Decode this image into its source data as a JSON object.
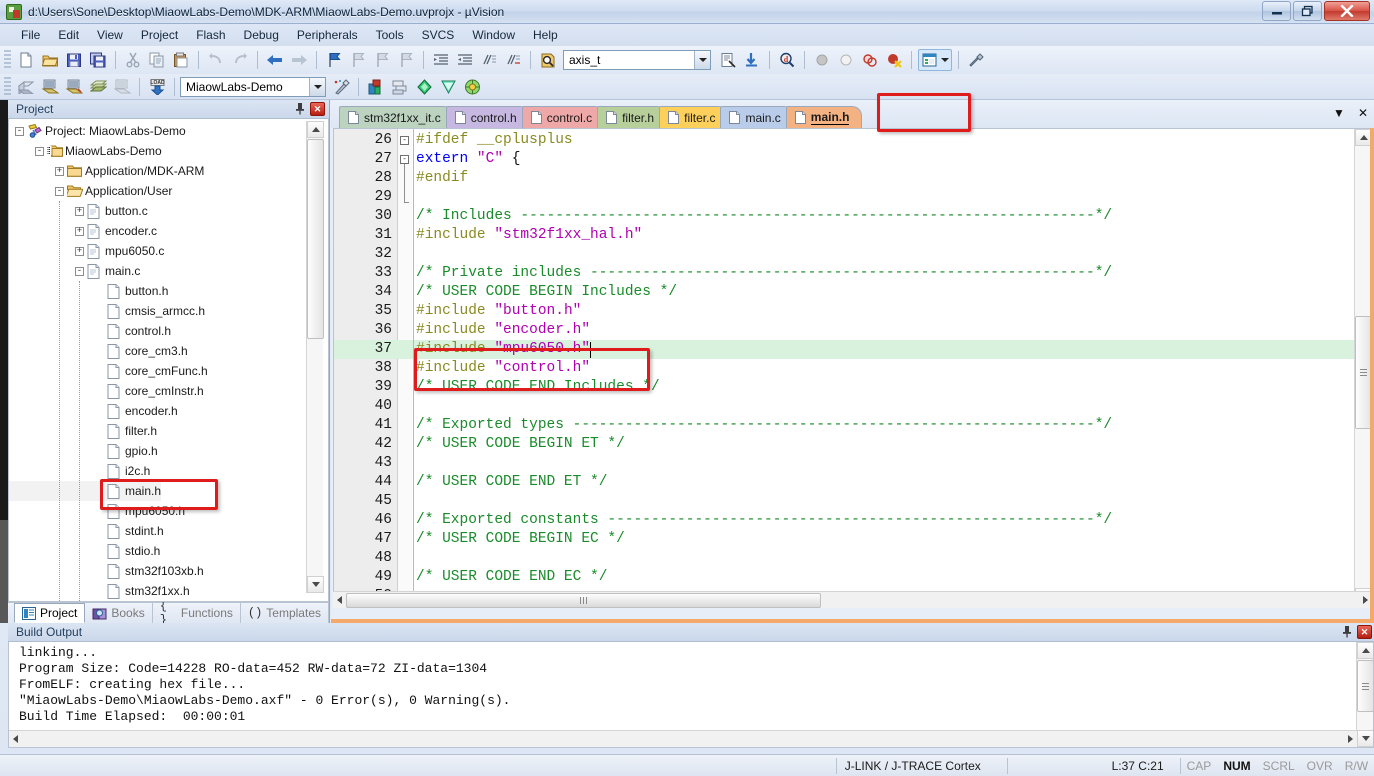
{
  "window": {
    "title": "d:\\Users\\Sone\\Desktop\\MiaowLabs-Demo\\MDK-ARM\\MiaowLabs-Demo.uvprojx - µVision",
    "app_icon": "uvision-icon",
    "minimize_label": "–",
    "maximize_label": "❐",
    "close_label": "✕"
  },
  "menubar": {
    "items": [
      {
        "label": "File"
      },
      {
        "label": "Edit"
      },
      {
        "label": "View"
      },
      {
        "label": "Project"
      },
      {
        "label": "Flash"
      },
      {
        "label": "Debug"
      },
      {
        "label": "Peripherals"
      },
      {
        "label": "Tools"
      },
      {
        "label": "SVCS"
      },
      {
        "label": "Window"
      },
      {
        "label": "Help"
      }
    ]
  },
  "toolbar_main": {
    "buttons": [
      {
        "name": "new-file-icon"
      },
      {
        "name": "open-file-icon"
      },
      {
        "name": "save-icon"
      },
      {
        "name": "save-all-icon"
      },
      {
        "name": "cut-icon"
      },
      {
        "name": "copy-icon"
      },
      {
        "name": "paste-icon"
      },
      {
        "name": "undo-icon"
      },
      {
        "name": "redo-icon"
      },
      {
        "name": "navigate-back-icon"
      },
      {
        "name": "navigate-forward-icon"
      },
      {
        "name": "bookmark-toggle-icon"
      },
      {
        "name": "bookmark-prev-icon"
      },
      {
        "name": "bookmark-next-icon"
      },
      {
        "name": "bookmark-clear-icon"
      },
      {
        "name": "indent-icon"
      },
      {
        "name": "outdent-icon"
      },
      {
        "name": "comment-icon"
      },
      {
        "name": "uncomment-icon"
      },
      {
        "name": "find-in-files-icon"
      }
    ],
    "search_value": "axis_t",
    "search_placeholder": "",
    "right_buttons": [
      {
        "name": "browse-info-icon"
      },
      {
        "name": "goto-definition-icon"
      },
      {
        "name": "find-icon"
      },
      {
        "name": "start-debug-grey-icon"
      },
      {
        "name": "stop-debug-grey-icon"
      },
      {
        "name": "insert-breakpoint-icon"
      },
      {
        "name": "kill-all-breakpoints-icon"
      },
      {
        "name": "manage-windows-icon"
      },
      {
        "name": "configure-icon"
      }
    ]
  },
  "toolbar_build": {
    "buttons": [
      {
        "name": "translate-file-icon"
      },
      {
        "name": "build-target-icon"
      },
      {
        "name": "rebuild-all-icon"
      },
      {
        "name": "batch-build-icon"
      },
      {
        "name": "stop-build-icon"
      },
      {
        "name": "download-to-flash-icon"
      }
    ],
    "target_value": "MiaowLabs-Demo",
    "right_buttons": [
      {
        "name": "target-options-wizard-icon"
      },
      {
        "name": "options-for-target-icon"
      },
      {
        "name": "manage-project-items-icon"
      },
      {
        "name": "pack-installer-icon"
      },
      {
        "name": "run-time-environment-icon"
      },
      {
        "name": "multi-project-icon"
      }
    ]
  },
  "project_panel": {
    "title": "Project",
    "pin_icon": "pin-icon",
    "close_icon": "close-icon",
    "tree": [
      {
        "label": "Project: MiaowLabs-Demo",
        "depth": 0,
        "expander": "-",
        "icon": "project-icon"
      },
      {
        "label": "MiaowLabs-Demo",
        "depth": 1,
        "expander": "-",
        "icon": "target-icon"
      },
      {
        "label": "Application/MDK-ARM",
        "depth": 2,
        "expander": "+",
        "icon": "folder-closed-icon"
      },
      {
        "label": "Application/User",
        "depth": 2,
        "expander": "-",
        "icon": "folder-open-icon"
      },
      {
        "label": "button.c",
        "depth": 3,
        "expander": "+",
        "icon": "c-file-icon"
      },
      {
        "label": "encoder.c",
        "depth": 3,
        "expander": "+",
        "icon": "c-file-icon"
      },
      {
        "label": "mpu6050.c",
        "depth": 3,
        "expander": "+",
        "icon": "c-file-icon"
      },
      {
        "label": "main.c",
        "depth": 3,
        "expander": "-",
        "icon": "c-file-icon"
      },
      {
        "label": "button.h",
        "depth": 4,
        "expander": "",
        "icon": "h-file-icon"
      },
      {
        "label": "cmsis_armcc.h",
        "depth": 4,
        "expander": "",
        "icon": "h-file-icon"
      },
      {
        "label": "control.h",
        "depth": 4,
        "expander": "",
        "icon": "h-file-icon"
      },
      {
        "label": "core_cm3.h",
        "depth": 4,
        "expander": "",
        "icon": "h-file-icon"
      },
      {
        "label": "core_cmFunc.h",
        "depth": 4,
        "expander": "",
        "icon": "h-file-icon"
      },
      {
        "label": "core_cmInstr.h",
        "depth": 4,
        "expander": "",
        "icon": "h-file-icon"
      },
      {
        "label": "encoder.h",
        "depth": 4,
        "expander": "",
        "icon": "h-file-icon"
      },
      {
        "label": "filter.h",
        "depth": 4,
        "expander": "",
        "icon": "h-file-icon"
      },
      {
        "label": "gpio.h",
        "depth": 4,
        "expander": "",
        "icon": "h-file-icon"
      },
      {
        "label": "i2c.h",
        "depth": 4,
        "expander": "",
        "icon": "h-file-icon"
      },
      {
        "label": "main.h",
        "depth": 4,
        "expander": "",
        "icon": "h-file-icon",
        "selected": true
      },
      {
        "label": "mpu6050.h",
        "depth": 4,
        "expander": "",
        "icon": "h-file-icon"
      },
      {
        "label": "stdint.h",
        "depth": 4,
        "expander": "",
        "icon": "h-file-icon"
      },
      {
        "label": "stdio.h",
        "depth": 4,
        "expander": "",
        "icon": "h-file-icon"
      },
      {
        "label": "stm32f103xb.h",
        "depth": 4,
        "expander": "",
        "icon": "h-file-icon"
      },
      {
        "label": "stm32f1xx.h",
        "depth": 4,
        "expander": "",
        "icon": "h-file-icon"
      }
    ],
    "tabs": [
      {
        "label": "Project",
        "icon": "project-tab-icon",
        "active": true
      },
      {
        "label": "Books",
        "icon": "books-tab-icon",
        "active": false
      },
      {
        "label": "Functions",
        "icon": "functions-tab-icon",
        "active": false
      },
      {
        "label": "Templates",
        "icon": "templates-tab-icon",
        "active": false
      }
    ]
  },
  "editor": {
    "tabs": [
      {
        "label": "stm32f1xx_it.c",
        "color": "#bcd3c0",
        "active": false
      },
      {
        "label": "control.h",
        "color": "#c6b8e0",
        "active": false
      },
      {
        "label": "control.c",
        "color": "#efa8a8",
        "active": false
      },
      {
        "label": "filter.h",
        "color": "#b7cf9a",
        "active": false
      },
      {
        "label": "filter.c",
        "color": "#fcd05a",
        "active": false
      },
      {
        "label": "main.c",
        "color": "#b9ccea",
        "active": false
      },
      {
        "label": "main.h",
        "color": "#f4b283",
        "active": true
      }
    ],
    "tab_controls": [
      {
        "name": "tab-list-dropdown-icon",
        "label": "▼"
      },
      {
        "name": "close-tab-icon",
        "label": "✕"
      }
    ],
    "first_line": 26,
    "current_line": 37,
    "lines": [
      {
        "n": 26,
        "fold": "-",
        "tokens": [
          {
            "t": "#ifdef __cplusplus",
            "c": "c-pre"
          }
        ]
      },
      {
        "n": 27,
        "fold": "-",
        "tokens": [
          {
            "t": "extern ",
            "c": "c-kw"
          },
          {
            "t": "\"C\"",
            "c": "c-str"
          },
          {
            "t": " {",
            "c": "c-plain"
          }
        ]
      },
      {
        "n": 28,
        "fold": "",
        "tokens": [
          {
            "t": "#endif",
            "c": "c-pre"
          }
        ]
      },
      {
        "n": 29,
        "fold": "",
        "tokens": []
      },
      {
        "n": 30,
        "fold": "",
        "tokens": [
          {
            "t": "/* Includes ------------------------------------------------------------------*/",
            "c": "c-comment"
          }
        ]
      },
      {
        "n": 31,
        "fold": "",
        "tokens": [
          {
            "t": "#include ",
            "c": "c-pre"
          },
          {
            "t": "\"stm32f1xx_hal.h\"",
            "c": "c-str"
          }
        ]
      },
      {
        "n": 32,
        "fold": "",
        "tokens": []
      },
      {
        "n": 33,
        "fold": "",
        "tokens": [
          {
            "t": "/* Private includes ----------------------------------------------------------*/",
            "c": "c-comment"
          }
        ]
      },
      {
        "n": 34,
        "fold": "",
        "tokens": [
          {
            "t": "/* USER CODE BEGIN Includes */",
            "c": "c-comment"
          }
        ]
      },
      {
        "n": 35,
        "fold": "",
        "tokens": [
          {
            "t": "#include ",
            "c": "c-pre"
          },
          {
            "t": "\"button.h\"",
            "c": "c-str"
          }
        ]
      },
      {
        "n": 36,
        "fold": "",
        "tokens": [
          {
            "t": "#include ",
            "c": "c-pre"
          },
          {
            "t": "\"encoder.h\"",
            "c": "c-str"
          }
        ]
      },
      {
        "n": 37,
        "fold": "",
        "current": true,
        "tokens": [
          {
            "t": "#include ",
            "c": "c-pre"
          },
          {
            "t": "\"mpu6050.h\"",
            "c": "c-str"
          }
        ]
      },
      {
        "n": 38,
        "fold": "",
        "tokens": [
          {
            "t": "#include ",
            "c": "c-pre"
          },
          {
            "t": "\"control.h\"",
            "c": "c-str"
          }
        ]
      },
      {
        "n": 39,
        "fold": "",
        "tokens": [
          {
            "t": "/* USER CODE END Includes */",
            "c": "c-comment"
          }
        ]
      },
      {
        "n": 40,
        "fold": "",
        "tokens": []
      },
      {
        "n": 41,
        "fold": "",
        "tokens": [
          {
            "t": "/* Exported types ------------------------------------------------------------*/",
            "c": "c-comment"
          }
        ]
      },
      {
        "n": 42,
        "fold": "",
        "tokens": [
          {
            "t": "/* USER CODE BEGIN ET */",
            "c": "c-comment"
          }
        ]
      },
      {
        "n": 43,
        "fold": "",
        "tokens": []
      },
      {
        "n": 44,
        "fold": "",
        "tokens": [
          {
            "t": "/* USER CODE END ET */",
            "c": "c-comment"
          }
        ]
      },
      {
        "n": 45,
        "fold": "",
        "tokens": []
      },
      {
        "n": 46,
        "fold": "",
        "tokens": [
          {
            "t": "/* Exported constants --------------------------------------------------------*/",
            "c": "c-comment"
          }
        ]
      },
      {
        "n": 47,
        "fold": "",
        "tokens": [
          {
            "t": "/* USER CODE BEGIN EC */",
            "c": "c-comment"
          }
        ]
      },
      {
        "n": 48,
        "fold": "",
        "tokens": []
      },
      {
        "n": 49,
        "fold": "",
        "tokens": [
          {
            "t": "/* USER CODE END EC */",
            "c": "c-comment"
          }
        ]
      },
      {
        "n": 50,
        "fold": "",
        "tokens": []
      }
    ]
  },
  "build_output": {
    "title": "Build Output",
    "pin_icon": "pin-icon",
    "close_icon": "close-icon",
    "lines": [
      "linking...",
      "Program Size: Code=14228 RO-data=452 RW-data=72 ZI-data=1304",
      "FromELF: creating hex file...",
      "\"MiaowLabs-Demo\\MiaowLabs-Demo.axf\" - 0 Error(s), 0 Warning(s).",
      "Build Time Elapsed:  00:00:01"
    ]
  },
  "statusbar": {
    "debugger": "J-LINK / J-TRACE Cortex",
    "position": "L:37 C:21",
    "flags": [
      {
        "label": "CAP",
        "on": false
      },
      {
        "label": "NUM",
        "on": true
      },
      {
        "label": "SCRL",
        "on": false
      },
      {
        "label": "OVR",
        "on": false
      },
      {
        "label": "R/W",
        "on": false
      }
    ]
  },
  "annotations": {
    "highlight_color": "#e01b1b",
    "boxes": [
      {
        "name": "main-h-tab-highlight"
      },
      {
        "name": "include-lines-highlight"
      },
      {
        "name": "main-h-tree-item-highlight"
      }
    ]
  }
}
